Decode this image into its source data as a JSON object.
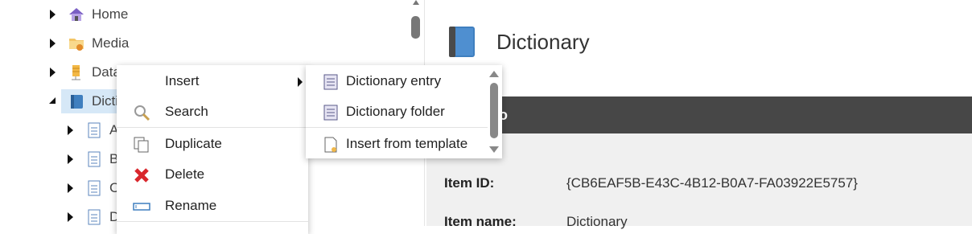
{
  "tree": {
    "items": [
      {
        "label": "Home",
        "icon": "house-icon"
      },
      {
        "label": "Media",
        "icon": "folder-icon"
      },
      {
        "label": "Data",
        "icon": "database-icon"
      },
      {
        "label": "Dicti",
        "icon": "book-icon",
        "expanded": true,
        "selected": true
      },
      {
        "label": "A",
        "icon": "document-icon"
      },
      {
        "label": "B",
        "icon": "document-icon"
      },
      {
        "label": "C",
        "icon": "document-icon"
      },
      {
        "label": "D",
        "icon": "document-icon"
      }
    ]
  },
  "content": {
    "title": "Dictionary",
    "section_title": "o",
    "fields": [
      {
        "label": "Item ID:",
        "value": "{CB6EAF5B-E43C-4B12-B0A7-FA03922E5757}"
      },
      {
        "label": "Item name:",
        "value": "Dictionary"
      }
    ]
  },
  "context_menu": {
    "items": [
      {
        "label": "Insert",
        "icon": "",
        "has_submenu": true
      },
      {
        "label": "Search",
        "icon": "magnifier-icon"
      },
      {
        "label": "Duplicate",
        "icon": "duplicate-icon"
      },
      {
        "label": "Delete",
        "icon": "delete-x-icon"
      },
      {
        "label": "Rename",
        "icon": "rename-icon"
      }
    ]
  },
  "submenu": {
    "items": [
      {
        "label": "Dictionary entry",
        "icon": "dictionary-entry-icon"
      },
      {
        "label": "Dictionary folder",
        "icon": "dictionary-folder-icon"
      },
      {
        "label": "Insert from template",
        "icon": "template-icon"
      }
    ]
  },
  "colors": {
    "selected_row": "#d6e8f7",
    "section_bar": "#474747",
    "fields_bg": "#f0f0f0",
    "delete_red": "#d9262c",
    "book_blue": "#3f7fbf"
  }
}
